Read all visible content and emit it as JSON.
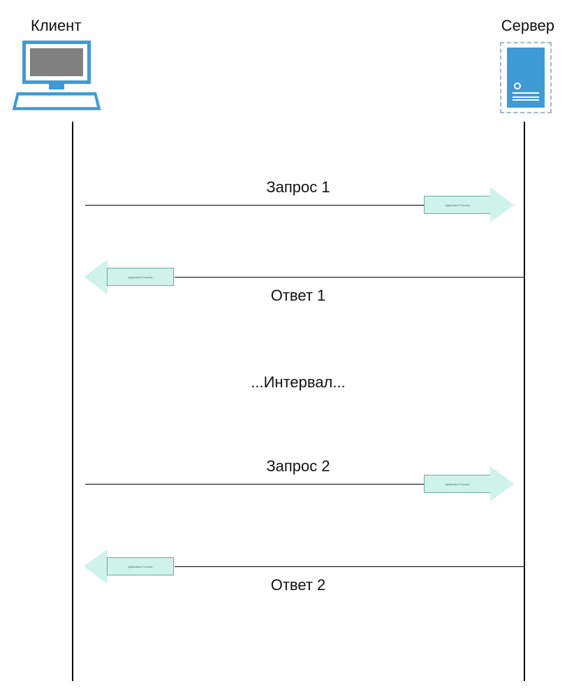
{
  "labels": {
    "client": "Клиент",
    "server": "Сервер",
    "request1": "Запрос 1",
    "response1": "Ответ 1",
    "interval": "...Интервал...",
    "request2": "Запрос 2",
    "response2": "Ответ 2",
    "arrow_small_text": "Application Process"
  },
  "colors": {
    "accent": "#3E9BD6",
    "arrow_fill": "#CFF2EA",
    "arrow_stroke": "#6FA89C",
    "screen_gray": "#808080",
    "dashed": "#9DB8C9"
  }
}
